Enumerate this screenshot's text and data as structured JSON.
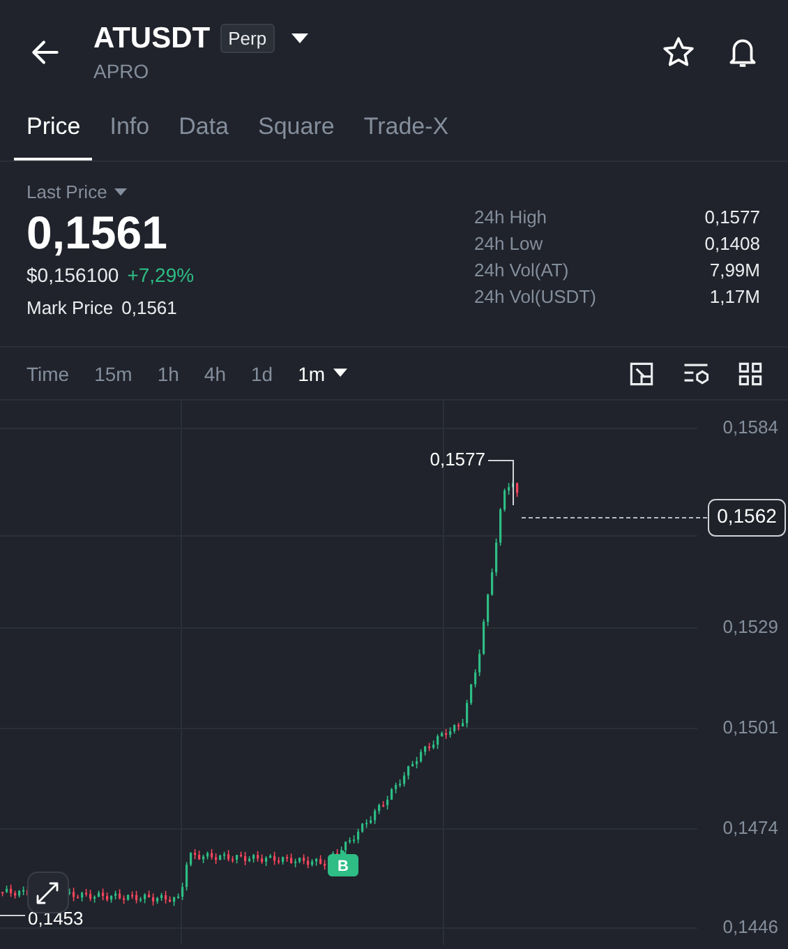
{
  "header": {
    "symbol": "ATUSDT",
    "badge": "Perp",
    "subtitle": "APRO"
  },
  "tabs": [
    {
      "label": "Price",
      "selected": true
    },
    {
      "label": "Info",
      "selected": false
    },
    {
      "label": "Data",
      "selected": false
    },
    {
      "label": "Square",
      "selected": false
    },
    {
      "label": "Trade-X",
      "selected": false
    }
  ],
  "price": {
    "label": "Last Price",
    "value": "0,1561",
    "usd": "$0,156100",
    "change": "+7,29%",
    "mark_label": "Mark Price",
    "mark_value": "0,1561"
  },
  "stats": [
    {
      "label": "24h High",
      "value": "0,1577"
    },
    {
      "label": "24h Low",
      "value": "0,1408"
    },
    {
      "label": "24h Vol(AT)",
      "value": "7,99M"
    },
    {
      "label": "24h Vol(USDT)",
      "value": "1,17M"
    }
  ],
  "intervals": [
    {
      "label": "Time",
      "selected": false
    },
    {
      "label": "15m",
      "selected": false
    },
    {
      "label": "1h",
      "selected": false
    },
    {
      "label": "4h",
      "selected": false
    },
    {
      "label": "1d",
      "selected": false
    },
    {
      "label": "1m",
      "selected": true
    }
  ],
  "chart": {
    "y_labels": [
      "0,1584",
      "0,1529",
      "0,1501",
      "0,1474",
      "0,1446"
    ],
    "high_label": "0,1577",
    "low_label": "0,1453",
    "current_price": "0,1562",
    "marker": "B"
  }
}
